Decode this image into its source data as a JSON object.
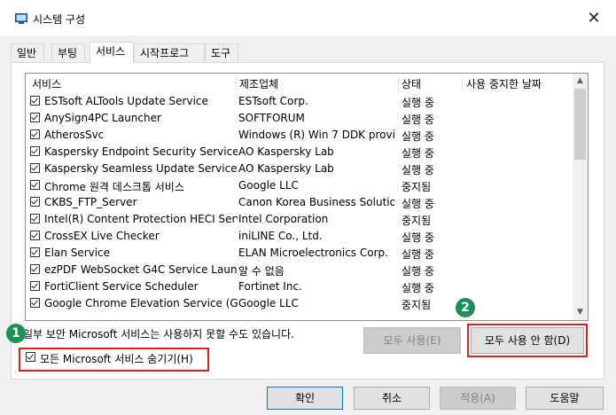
{
  "window": {
    "title": "시스템 구성",
    "close_glyph": "✕"
  },
  "tabs": [
    {
      "label": "일반",
      "active": false
    },
    {
      "label": "부팅",
      "active": false
    },
    {
      "label": "서비스",
      "active": true
    },
    {
      "label": "시작프로그램",
      "active": false
    },
    {
      "label": "도구",
      "active": false
    }
  ],
  "list": {
    "headers": {
      "service": "서비스",
      "maker": "제조업체",
      "state": "상태",
      "disabled_date": "사용 중지한 날짜"
    },
    "rows": [
      {
        "name": "ESTsoft ALTools Update Service",
        "maker": "ESTsoft Corp.",
        "state": "실행 중",
        "checked": true
      },
      {
        "name": "AnySign4PC Launcher",
        "maker": "SOFTFORUM",
        "state": "실행 중",
        "checked": true
      },
      {
        "name": "AtherosSvc",
        "maker": "Windows (R) Win 7 DDK provi...",
        "state": "실행 중",
        "checked": true
      },
      {
        "name": "Kaspersky Endpoint Security Service",
        "maker": "AO Kaspersky Lab",
        "state": "실행 중",
        "checked": true
      },
      {
        "name": "Kaspersky Seamless Update Service",
        "maker": "AO Kaspersky Lab",
        "state": "실행 중",
        "checked": true
      },
      {
        "name": "Chrome 원격 데스크톱 서비스",
        "maker": "Google LLC",
        "state": "중지됨",
        "checked": true
      },
      {
        "name": "CKBS_FTP_Server",
        "maker": "Canon Korea Business Solutio...",
        "state": "실행 중",
        "checked": true
      },
      {
        "name": "Intel(R) Content Protection HECI Serv...",
        "maker": "Intel Corporation",
        "state": "중지됨",
        "checked": true
      },
      {
        "name": "CrossEX Live Checker",
        "maker": "iniLINE Co., Ltd.",
        "state": "실행 중",
        "checked": true
      },
      {
        "name": "Elan Service",
        "maker": "ELAN Microelectronics Corp.",
        "state": "실행 중",
        "checked": true
      },
      {
        "name": "ezPDF WebSocket G4C Service Launc...",
        "maker": "알 수 없음",
        "state": "실행 중",
        "checked": true
      },
      {
        "name": "FortiClient Service Scheduler",
        "maker": "Fortinet Inc.",
        "state": "실행 중",
        "checked": true
      },
      {
        "name": "Google Chrome Elevation Service (G...",
        "maker": "Google LLC",
        "state": "중지됨",
        "checked": true
      }
    ]
  },
  "note": "일부 보안 Microsoft 서비스는 사용하지 못할 수도 있습니다.",
  "hide_ms": {
    "label": "모든 Microsoft 서비스 숨기기(H)",
    "checked": true
  },
  "buttons": {
    "enable_all": "모두 사용(E)",
    "disable_all": "모두 사용 안 함(D)",
    "ok": "확인",
    "cancel": "취소",
    "apply": "적용(A)",
    "help": "도움말"
  },
  "markers": {
    "one": "1",
    "two": "2"
  },
  "colors": {
    "highlight": "#e0201e",
    "marker": "#1f8f5a",
    "accent": "#0078d7"
  }
}
